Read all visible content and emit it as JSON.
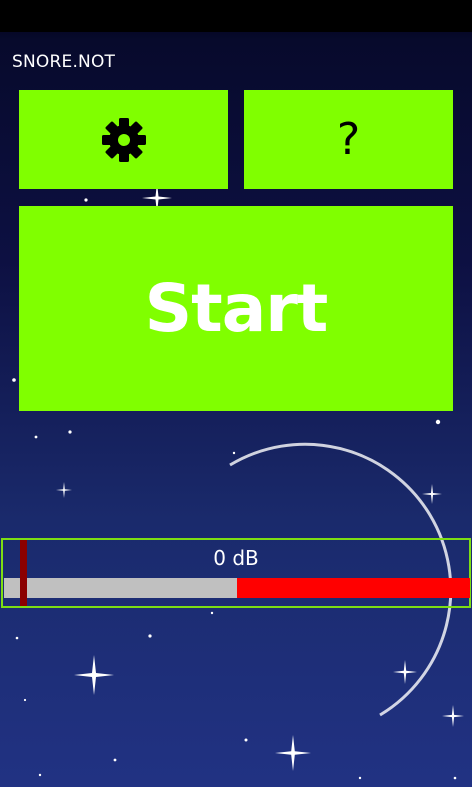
{
  "app": {
    "title": "SNORE.NOT"
  },
  "tiles": {
    "settings": {
      "icon": "gear-icon"
    },
    "help": {
      "label": "?",
      "icon": "question-mark-icon"
    },
    "start": {
      "label": "Start"
    }
  },
  "meter": {
    "value_label": "0 dB",
    "threshold_fraction": 0.5,
    "level_fraction": 0.0
  },
  "colors": {
    "tile_green": "#80ff00",
    "meter_border": "#7dde14",
    "meter_red": "#ff0000",
    "meter_gray": "#c0c0c0",
    "needle": "#8b0000",
    "sky_top": "#000010",
    "sky_bottom": "#213283"
  }
}
